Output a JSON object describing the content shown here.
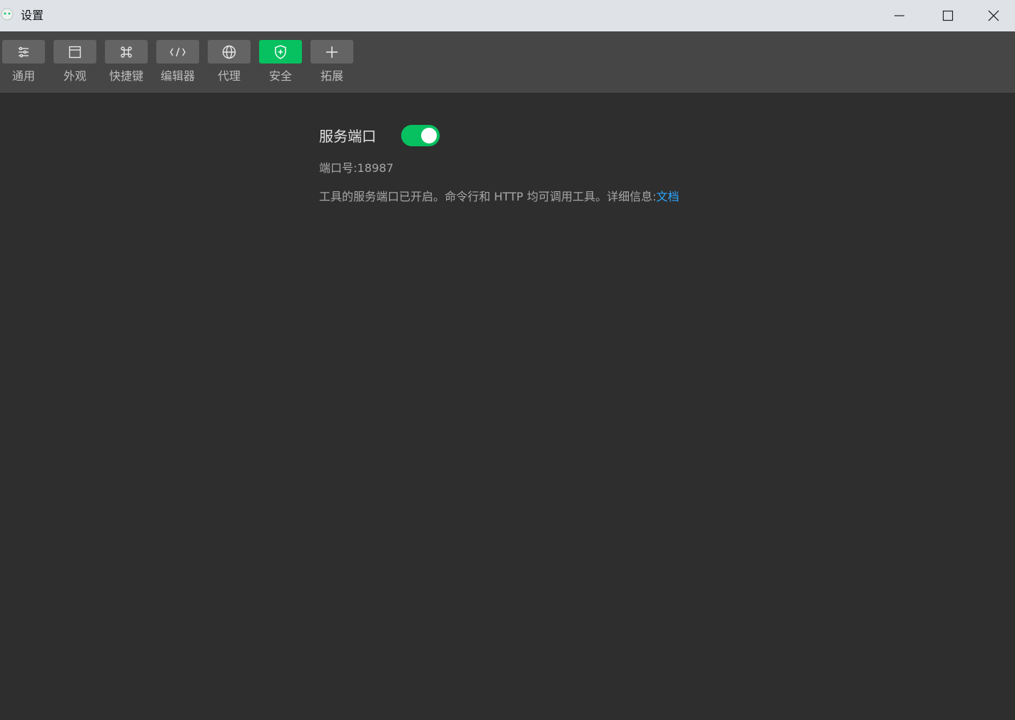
{
  "window": {
    "title": "设置",
    "controls": {
      "minimize": "minimize-icon",
      "maximize": "maximize-icon",
      "close": "close-icon"
    }
  },
  "toolbar": {
    "items": [
      {
        "label": "通用",
        "icon": "sliders-icon",
        "active": false
      },
      {
        "label": "外观",
        "icon": "window-layout-icon",
        "active": false
      },
      {
        "label": "快捷键",
        "icon": "command-key-icon",
        "active": false
      },
      {
        "label": "编辑器",
        "icon": "code-icon",
        "active": false
      },
      {
        "label": "代理",
        "icon": "globe-icon",
        "active": false
      },
      {
        "label": "安全",
        "icon": "shield-icon",
        "active": true
      },
      {
        "label": "拓展",
        "icon": "plus-icon",
        "active": false
      }
    ]
  },
  "service_port": {
    "title": "服务端口",
    "enabled": true,
    "port_label": "端口号:",
    "port_value": "18987",
    "description": "工具的服务端口已开启。命令行和 HTTP 均可调用工具。详细信息:",
    "link_text": "文档"
  },
  "colors": {
    "accent": "#07c160",
    "link": "#2aa7ff",
    "background": "#2e2e2e",
    "toolbar": "#464646",
    "titlebar": "#dfe3e8"
  }
}
